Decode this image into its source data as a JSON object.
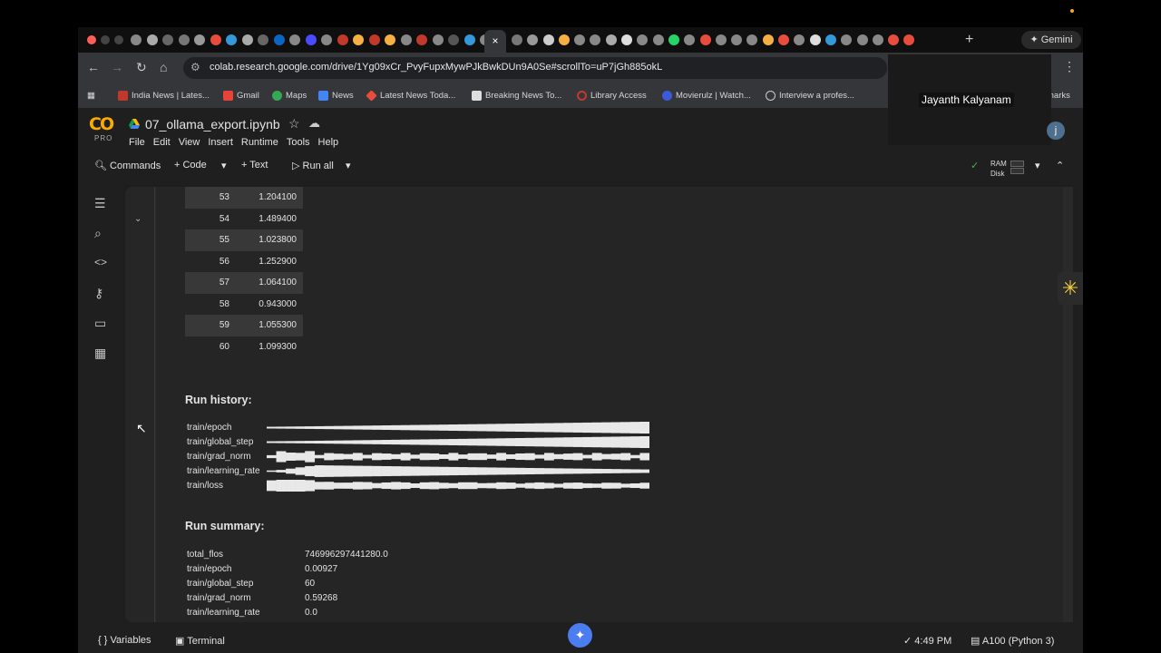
{
  "browser": {
    "url": "colab.research.google.com/drive/1Yg09xCr_PvyFupxMywPJkBwkDUn9A0Se#scrollTo=uP7jGh885okL",
    "gemini_label": "Gemini",
    "active_tab_close": "×",
    "new_tab": "+",
    "bookmarks": [
      "India News | Lates...",
      "Gmail",
      "Maps",
      "News",
      "Latest News Toda...",
      "Breaking News To...",
      "Library Access",
      "Movierulz | Watch...",
      "Interview a profes..."
    ],
    "bookmarks_tail": "marks"
  },
  "overlay": {
    "presenter_name": "Jayanth Kalyanam",
    "avatar_initial": "j"
  },
  "colab": {
    "logo": "CO",
    "tier": "PRO",
    "notebook_title": "07_ollama_export.ipynb",
    "menu": [
      "File",
      "Edit",
      "View",
      "Insert",
      "Runtime",
      "Tools",
      "Help"
    ],
    "toolbar": {
      "commands": "Commands",
      "code": "Code",
      "text": "Text",
      "run_all": "Run all",
      "ram": "RAM",
      "disk": "Disk"
    }
  },
  "output": {
    "steps": [
      {
        "step": "53",
        "loss": "1.204100"
      },
      {
        "step": "54",
        "loss": "1.489400"
      },
      {
        "step": "55",
        "loss": "1.023800"
      },
      {
        "step": "56",
        "loss": "1.252900"
      },
      {
        "step": "57",
        "loss": "1.064100"
      },
      {
        "step": "58",
        "loss": "0.943000"
      },
      {
        "step": "59",
        "loss": "1.055300"
      },
      {
        "step": "60",
        "loss": "1.099300"
      }
    ],
    "run_history_title": "Run history:",
    "run_history": [
      {
        "name": "train/epoch",
        "shape": "ramp"
      },
      {
        "name": "train/global_step",
        "shape": "ramp"
      },
      {
        "name": "train/grad_norm",
        "shape": "noisy"
      },
      {
        "name": "train/learning_rate",
        "shape": "hump"
      },
      {
        "name": "train/loss",
        "shape": "decay"
      }
    ],
    "run_summary_title": "Run summary:",
    "run_summary": [
      {
        "key": "total_flos",
        "value": "746996297441280.0"
      },
      {
        "key": "train/epoch",
        "value": "0.00927"
      },
      {
        "key": "train/global_step",
        "value": "60"
      },
      {
        "key": "train/grad_norm",
        "value": "0.59268"
      },
      {
        "key": "train/learning_rate",
        "value": "0.0"
      }
    ]
  },
  "statusbar": {
    "variables": "Variables",
    "terminal": "Terminal",
    "time": "4:49 PM",
    "runtime": "A100 (Python 3)"
  },
  "colors": {
    "accent_blue": "#4b7cf0",
    "colab_orange": "#f9ab00",
    "sparkline": "#e8e8e8"
  }
}
